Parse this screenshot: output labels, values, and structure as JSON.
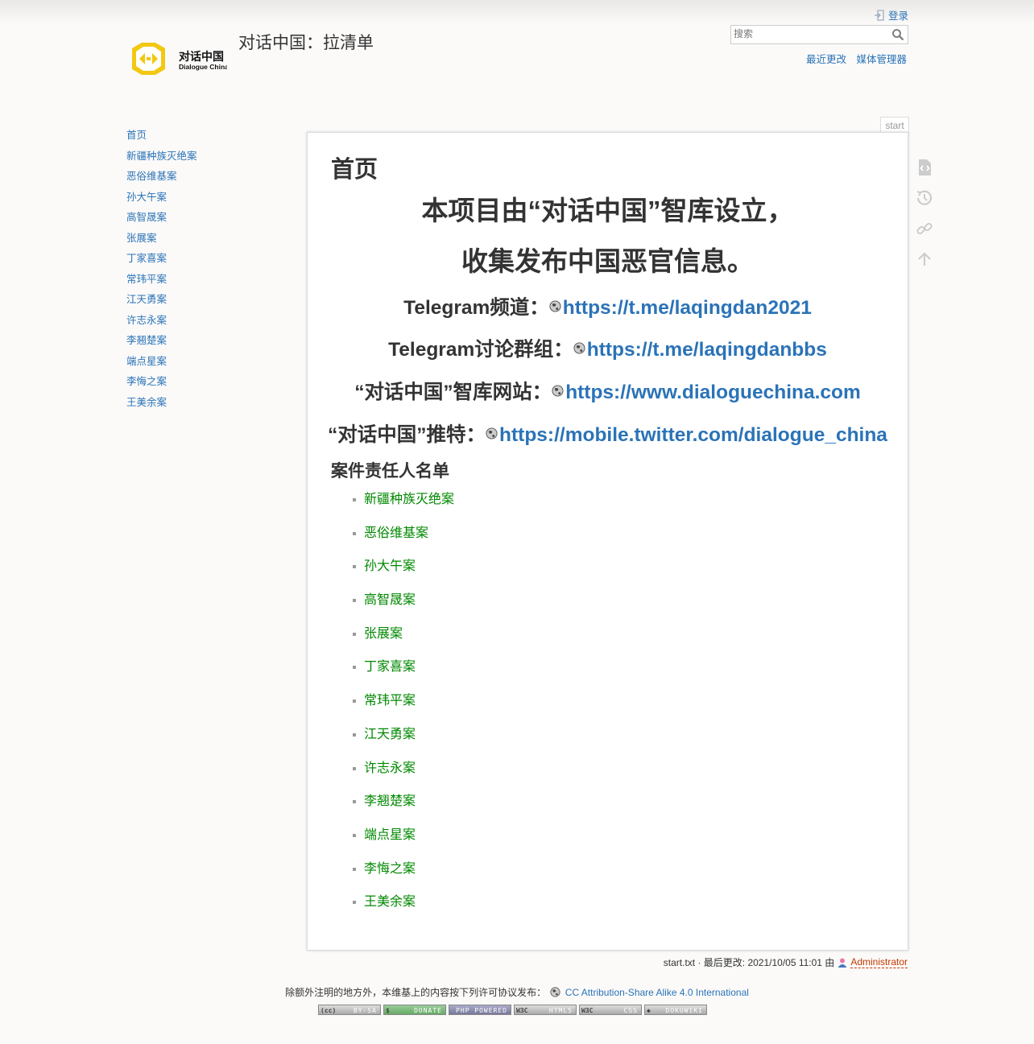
{
  "header": {
    "site_title": "对话中国：拉清单",
    "logo_text_cn": "对话中国",
    "logo_text_en": "Dialogue China",
    "login_label": "登录",
    "search_placeholder": "搜索",
    "tools": [
      "最近更改",
      "媒体管理器"
    ]
  },
  "sidebar": {
    "items": [
      "首页",
      "新疆种族灭绝案",
      "恶俗维基案",
      "孙大午案",
      "高智晟案",
      "张展案",
      "丁家喜案",
      "常玮平案",
      "江天勇案",
      "许志永案",
      "李翘楚案",
      "端点星案",
      "李悔之案",
      "王美余案"
    ]
  },
  "page": {
    "id": "start",
    "title": "首页",
    "banner_line1": "本项目由“对话中国”智库设立，",
    "banner_line2": "收集发布中国恶官信息。",
    "links": [
      {
        "label": "Telegram频道：",
        "url": "https://t.me/laqingdan2021"
      },
      {
        "label": "Telegram讨论群组：",
        "url": "https://t.me/laqingdanbbs"
      },
      {
        "label": "“对话中国”智库网站：",
        "url": "https://www.dialoguechina.com"
      },
      {
        "label": "“对话中国”推特：",
        "url": "https://mobile.twitter.com/dialogue_china"
      }
    ],
    "cases_heading": "案件责任人名单",
    "cases": [
      "新疆种族灭绝案",
      "恶俗维基案",
      "孙大午案",
      "高智晟案",
      "张展案",
      "丁家喜案",
      "常玮平案",
      "江天勇案",
      "许志永案",
      "李翘楚案",
      "端点星案",
      "李悔之案",
      "王美余案"
    ]
  },
  "footer": {
    "doc_info": "start.txt · 最后更改: 2021/10/05 11:01 由",
    "author": "Administrator",
    "license_text": "除额外注明的地方外，本维基上的内容按下列许可协议发布：",
    "license_link": "CC Attribution-Share Alike 4.0 International",
    "badges": [
      "BY-SA",
      "DONATE",
      "PHP POWERED",
      "HTML5",
      "CSS",
      "DOKUWIKI"
    ]
  }
}
